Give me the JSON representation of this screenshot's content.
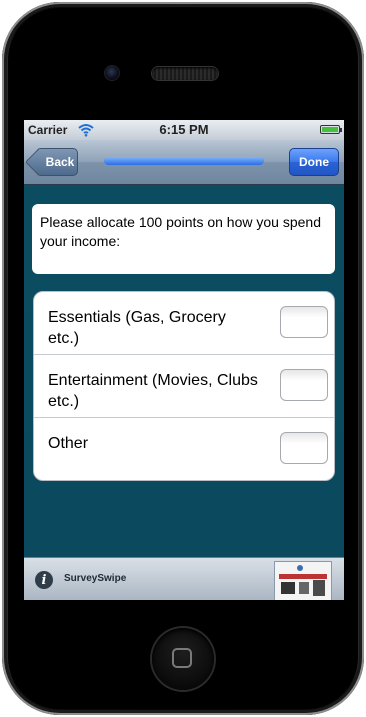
{
  "status_bar": {
    "carrier": "Carrier",
    "time": "6:15 PM",
    "battery_level": 1.0
  },
  "nav_bar": {
    "back_label": "Back",
    "done_label": "Done",
    "progress": 1.0
  },
  "question": {
    "text": "Please allocate 100 points on how you spend your income:"
  },
  "options": [
    {
      "label": "Essentials (Gas, Grocery etc.)",
      "value": ""
    },
    {
      "label": "Entertainment (Movies, Clubs etc.)",
      "value": ""
    },
    {
      "label": "Other",
      "value": ""
    }
  ],
  "bottom_bar": {
    "app_name": "SurveySwipe",
    "info_icon": "info-icon",
    "ad_image": "ad-thumbnail"
  },
  "colors": {
    "accent": "#2a63d6",
    "background": "#0b4a5e",
    "battery": "#46c23a"
  }
}
